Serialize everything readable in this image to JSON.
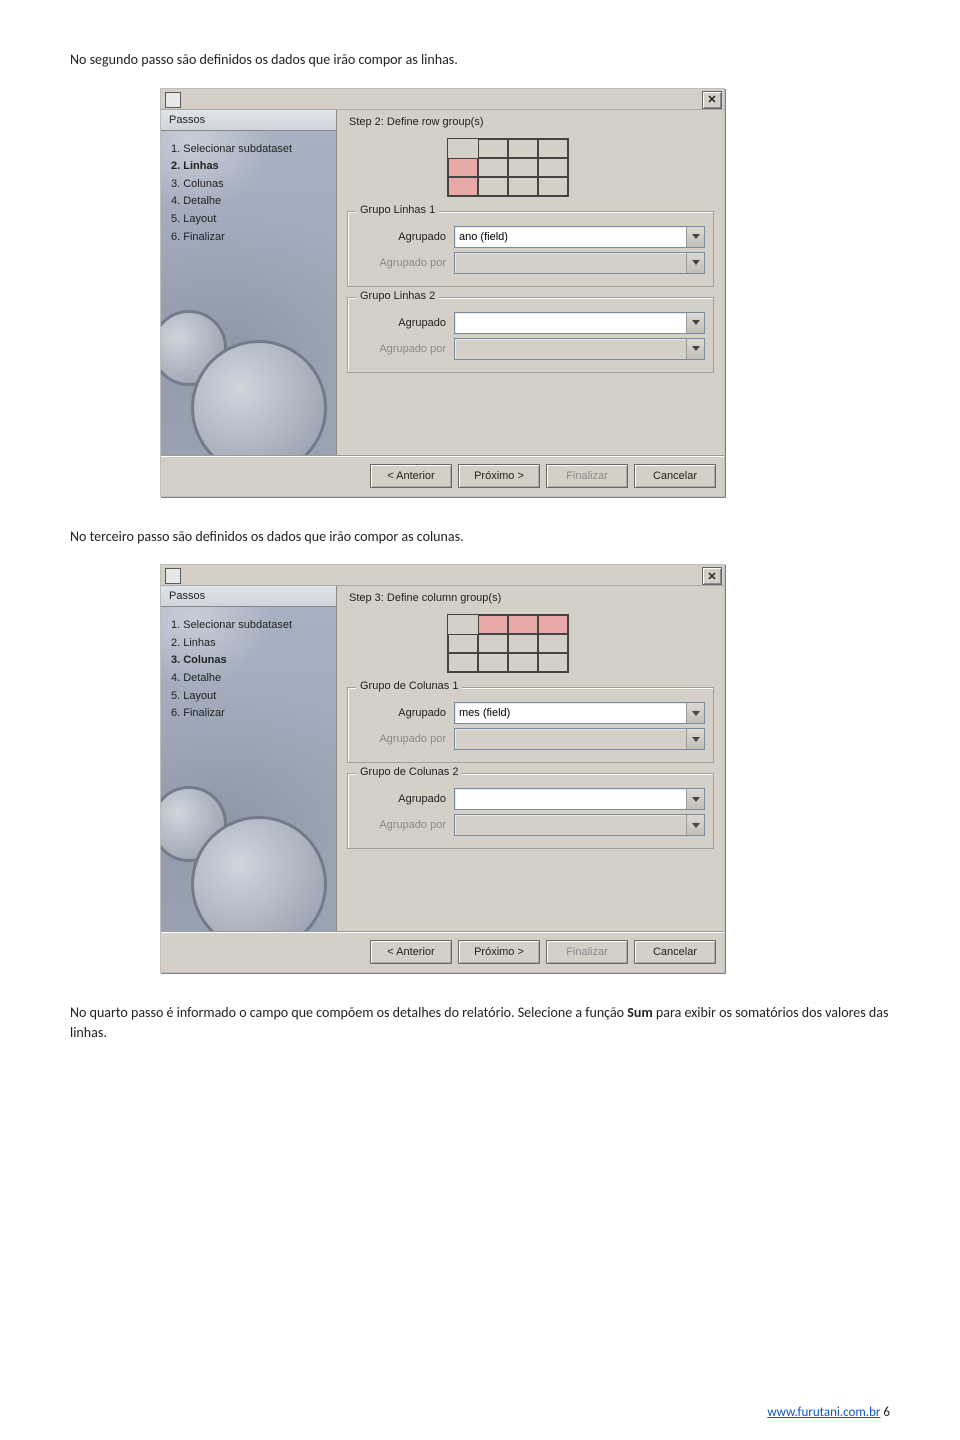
{
  "text": {
    "para1": "No segundo passo são definidos os dados que irão compor as linhas.",
    "para2": "No terceiro passo são definidos os dados que irão compor as colunas.",
    "para3_a": "No quarto passo é informado o campo que compõem os detalhes do relatório. Selecione a função ",
    "para3_bold": "Sum",
    "para3_b": " para exibir os somatórios dos valores das linhas."
  },
  "dialog1": {
    "side_heading": "Passos",
    "steps": [
      "1. Selecionar subdataset",
      "2. Linhas",
      "3. Colunas",
      "4. Detalhe",
      "5. Layout",
      "6. Finalizar"
    ],
    "active_index": 1,
    "title": "Step 2: Define row group(s)",
    "group1_legend": "Grupo Linhas 1",
    "group2_legend": "Grupo Linhas 2",
    "label_agrupado": "Agrupado",
    "label_agrupado_por": "Agrupado por",
    "group1_value": "ano (field)"
  },
  "dialog2": {
    "side_heading": "Passos",
    "steps": [
      "1. Selecionar subdataset",
      "2. Linhas",
      "3. Colunas",
      "4. Detalhe",
      "5. Layout",
      "6. Finalizar"
    ],
    "active_index": 2,
    "title": "Step 3: Define column group(s)",
    "group1_legend": "Grupo de Colunas 1",
    "group2_legend": "Grupo de Colunas 2",
    "label_agrupado": "Agrupado",
    "label_agrupado_por": "Agrupado por",
    "group1_value": "mes (field)"
  },
  "buttons": {
    "prev": "< Anterior",
    "next": "Próximo >",
    "finish": "Finalizar",
    "cancel": "Cancelar"
  },
  "footer": {
    "url": "www.furutani.com.br",
    "page": "6"
  }
}
